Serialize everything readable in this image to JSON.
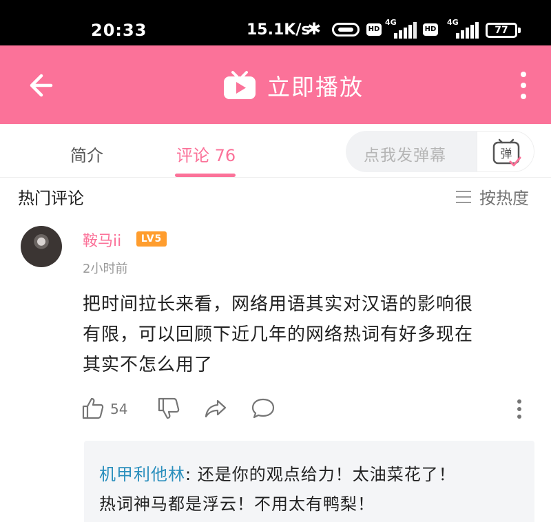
{
  "status_bar": {
    "time": "20:33",
    "net_speed": "15.1K/s",
    "hd_badge": "HD",
    "network_type": "4G",
    "battery": "77"
  },
  "header": {
    "title": "立即播放",
    "icons": [
      "back-arrow-icon",
      "tv-play-icon",
      "more-vertical-icon"
    ],
    "background_color": "#fb7299"
  },
  "tabs": [
    {
      "label": "简介",
      "active": false
    },
    {
      "label": "评论 76",
      "active": true
    }
  ],
  "danmu": {
    "placeholder": "点我发弹幕",
    "button_icon": "danmu-icon",
    "button_text": "弹"
  },
  "section": {
    "title": "热门评论",
    "sort_label": "按热度",
    "sort_icon": "list-icon"
  },
  "comment": {
    "username": "鞍马ii",
    "level": "LV5",
    "time": "2小时前",
    "text_lines": [
      "把时间拉长来看，网络用语其实对汉语的影响很",
      "有限，可以回顾下近几年的网络热词有好多现在",
      "其实不怎么用了"
    ],
    "likes": "54",
    "action_icons": [
      "thumbs-up-icon",
      "thumbs-down-icon",
      "share-icon",
      "reply-bubble-icon",
      "more-vertical-icon"
    ]
  },
  "reply": {
    "username": "机甲利他林",
    "separator": ":",
    "text_lines": [
      " 还是你的观点给力！太油菜花了！",
      "热词神马都是浮云！不用太有鸭梨！"
    ]
  },
  "colors": {
    "accent": "#fb7299",
    "level_badge": "#ff9d2e",
    "reply_name": "#2a8fbd"
  }
}
